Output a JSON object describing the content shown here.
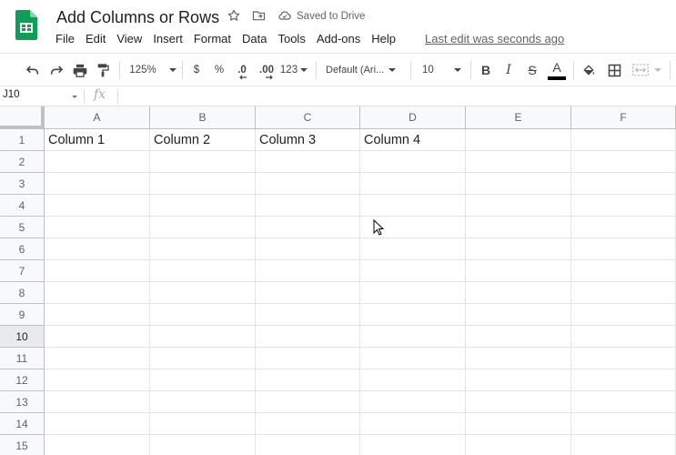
{
  "app": {
    "title": "Add Columns or Rows",
    "save_status": "Saved to Drive",
    "last_edit": "Last edit was seconds ago",
    "brand_color": "#0f9d58"
  },
  "menu": [
    "File",
    "Edit",
    "View",
    "Insert",
    "Format",
    "Data",
    "Tools",
    "Add-ons",
    "Help"
  ],
  "toolbar": {
    "zoom": "125%",
    "currency": "$",
    "percent": "%",
    "decrease_decimals": ".0",
    "increase_decimals": ".00",
    "more_formats": "123",
    "font": "Default (Ari...",
    "font_size": "10",
    "bold": "B",
    "italic": "I",
    "strikethrough": "S",
    "text_color": "A",
    "text_color_swatch": "#000000",
    "icons": [
      "undo-icon",
      "redo-icon",
      "print-icon",
      "paint-format-icon",
      "fill-color-icon",
      "borders-icon",
      "merge-cells-icon"
    ]
  },
  "formula_bar": {
    "name_box": "J10",
    "fx": "fx",
    "value": ""
  },
  "sheet": {
    "columns": [
      "A",
      "B",
      "C",
      "D",
      "E",
      "F"
    ],
    "rows": [
      "1",
      "2",
      "3",
      "4",
      "5",
      "6",
      "7",
      "8",
      "9",
      "10",
      "11",
      "12",
      "13",
      "14",
      "15"
    ],
    "selected_row": "10",
    "cells": {
      "A1": "Column 1",
      "B1": "Column 2",
      "C1": "Column 3",
      "D1": "Column 4"
    }
  }
}
